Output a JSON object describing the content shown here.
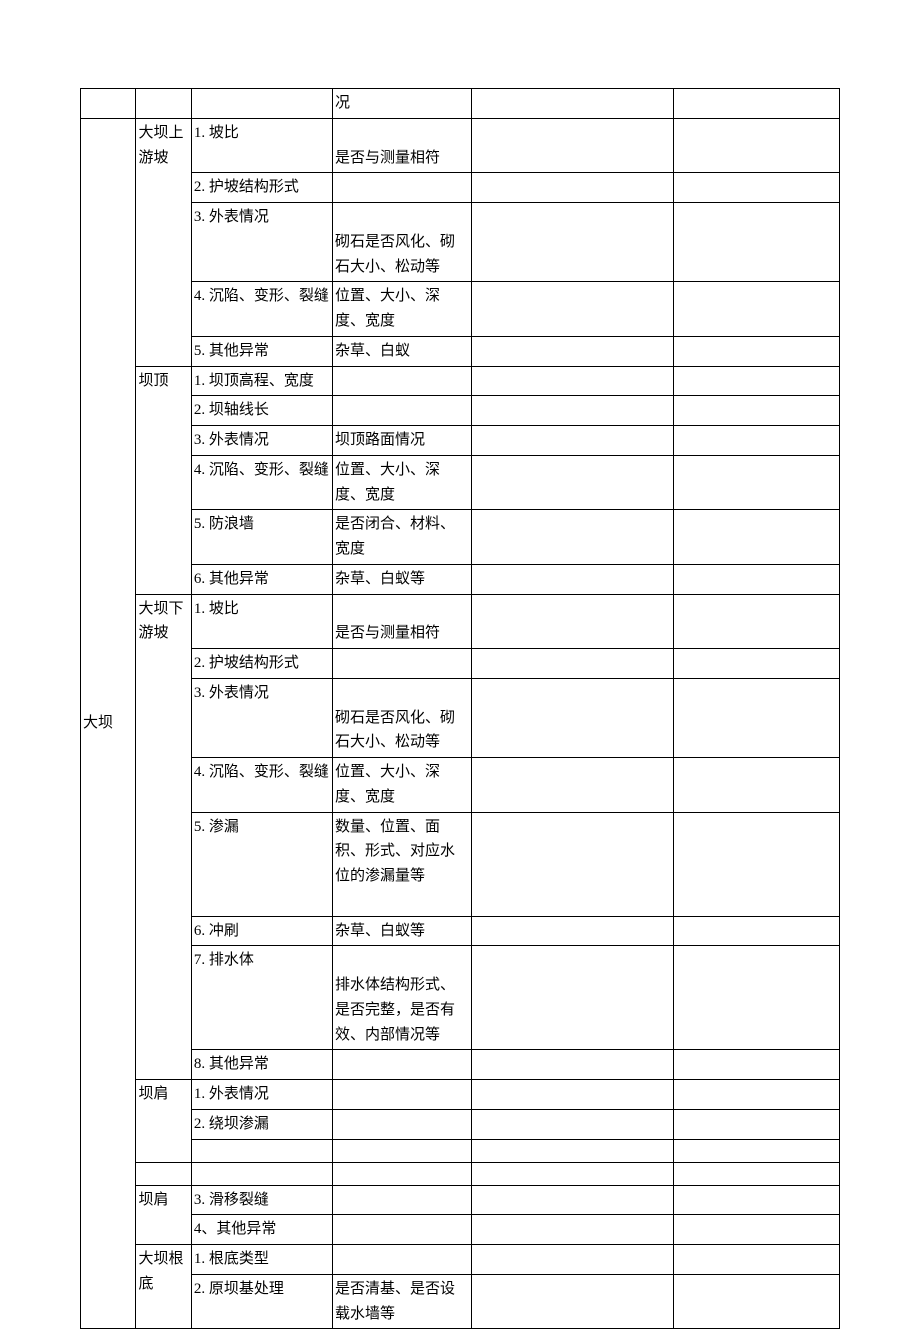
{
  "rows": {
    "r1_c4": "况",
    "r2_c1": "大坝",
    "r2_c2": "大坝上游坡",
    "r2_c3": "1. 坡比",
    "r2_c4": "是否与测量相符",
    "r3_c3": "2. 护坡结构形式",
    "r4_c3": "3. 外表情况",
    "r4_c4": "砌石是否风化、砌石大小、松动等",
    "r5_c3": "4. 沉陷、变形、裂缝",
    "r5_c4": "位置、大小、深度、宽度",
    "r6_c3": "5. 其他异常",
    "r6_c4": "杂草、白蚁",
    "r7_c2": "坝顶",
    "r7_c3": "1. 坝顶高程、宽度",
    "r8_c3": "2. 坝轴线长",
    "r9_c3": "3. 外表情况",
    "r9_c4": "坝顶路面情况",
    "r10_c3": "4. 沉陷、变形、裂缝",
    "r10_c4": "位置、大小、深度、宽度",
    "r11_c3": "5. 防浪墙",
    "r11_c4": "是否闭合、材料、宽度",
    "r12_c3": "6. 其他异常",
    "r12_c4": "杂草、白蚁等",
    "r13_c2": "大坝下游坡",
    "r13_c3": "1. 坡比",
    "r13_c4": "是否与测量相符",
    "r14_c3": "2. 护坡结构形式",
    "r15_c3": "3. 外表情况",
    "r15_c4": "砌石是否风化、砌石大小、松动等",
    "r16_c3": "4. 沉陷、变形、裂缝",
    "r16_c4": "位置、大小、深度、宽度",
    "r17_c3": "5. 渗漏",
    "r17_c4": "数量、位置、面积、形式、对应水位的渗漏量等",
    "r18_c3": "6. 冲刷",
    "r18_c4": "杂草、白蚁等",
    "r19_c3": "7. 排水体",
    "r19_c4": "排水体结构形式、是否完整，是否有效、内部情况等",
    "r20_c3": "8. 其他异常",
    "r21_c2": "坝肩",
    "r21_c3": "1. 外表情况",
    "r22_c3": "2. 绕坝渗漏",
    "r23_c2": "坝肩",
    "r23_c3": "3. 滑移裂缝",
    "r24_c3": "4、其他异常",
    "r25_c2": "大坝根底",
    "r25_c3": "1. 根底类型",
    "r26_c3": "2. 原坝基处理",
    "r26_c4": "是否清基、是否设载水墙等"
  }
}
